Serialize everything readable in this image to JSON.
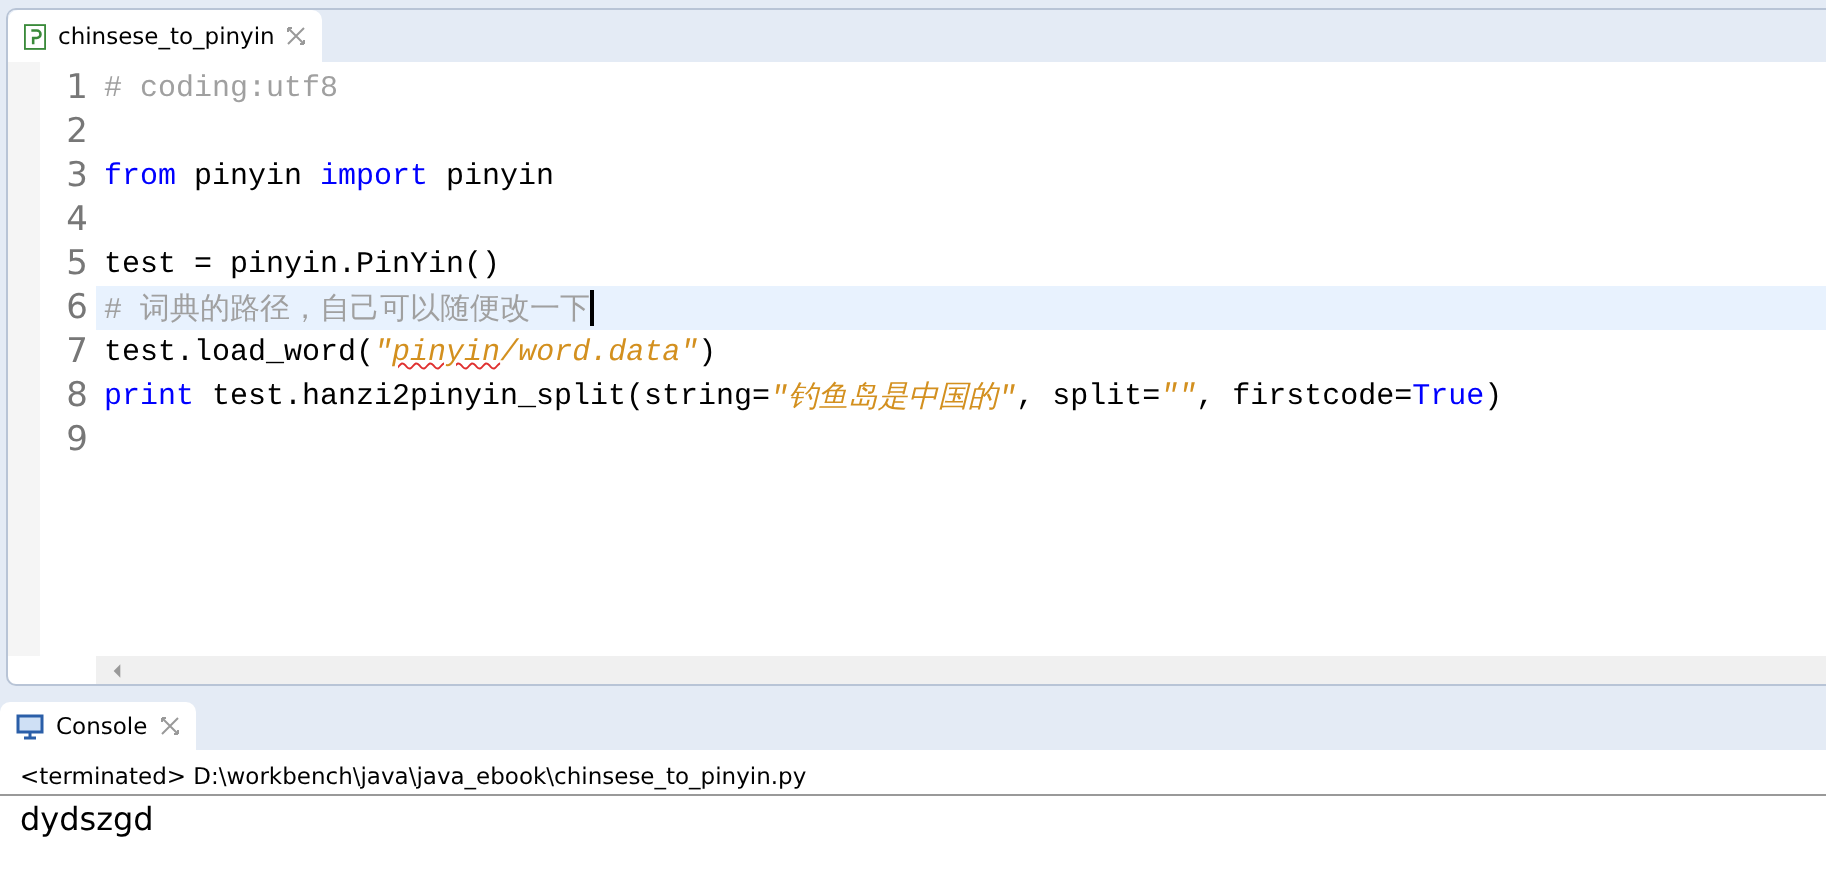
{
  "editor": {
    "tabs": [
      {
        "label": "chinsese_to_pinyin",
        "selected": true
      }
    ],
    "lines": [
      {
        "number": "1",
        "current": false,
        "tokens": [
          {
            "kind": "comment",
            "text": "# coding:utf8"
          }
        ]
      },
      {
        "number": "2",
        "current": false
      },
      {
        "number": "3",
        "current": false,
        "tokens": [
          {
            "kind": "keyword",
            "text": "from"
          },
          {
            "kind": "plain",
            "text": " pinyin "
          },
          {
            "kind": "keyword",
            "text": "import"
          },
          {
            "kind": "plain",
            "text": " pinyin"
          }
        ]
      },
      {
        "number": "4",
        "current": false
      },
      {
        "number": "5",
        "current": false,
        "tokens": [
          {
            "kind": "plain",
            "text": "test = pinyin.PinYin()"
          }
        ]
      },
      {
        "number": "6",
        "current": true,
        "tokens": [
          {
            "kind": "comment",
            "text": "# 词典的路径，自己可以随便改一下"
          }
        ]
      },
      {
        "number": "7",
        "current": false,
        "tokens": [
          {
            "kind": "plain",
            "text": "test.load_word("
          },
          {
            "kind": "string",
            "text": "\""
          },
          {
            "kind": "string",
            "text": "pinyin",
            "misspelled": true
          },
          {
            "kind": "string",
            "text": "/word.data\""
          },
          {
            "kind": "plain",
            "text": ")"
          }
        ]
      },
      {
        "number": "8",
        "current": false,
        "tokens": [
          {
            "kind": "keyword",
            "text": "print"
          },
          {
            "kind": "plain",
            "text": " test.hanzi2pinyin_split(string="
          },
          {
            "kind": "string",
            "text": "\"钓鱼岛是中国的\""
          },
          {
            "kind": "plain",
            "text": ", split="
          },
          {
            "kind": "string",
            "text": "\"\""
          },
          {
            "kind": "plain",
            "text": ", firstcode="
          },
          {
            "kind": "constant",
            "text": "True"
          },
          {
            "kind": "plain",
            "text": ")"
          }
        ]
      },
      {
        "number": "9",
        "current": false
      }
    ]
  },
  "console": {
    "tabs": [
      {
        "label": "Console",
        "selected": true
      }
    ],
    "status": "<terminated> D:\\workbench\\java\\java_ebook\\chinsese_to_pinyin.py",
    "output": "dydszgd"
  }
}
